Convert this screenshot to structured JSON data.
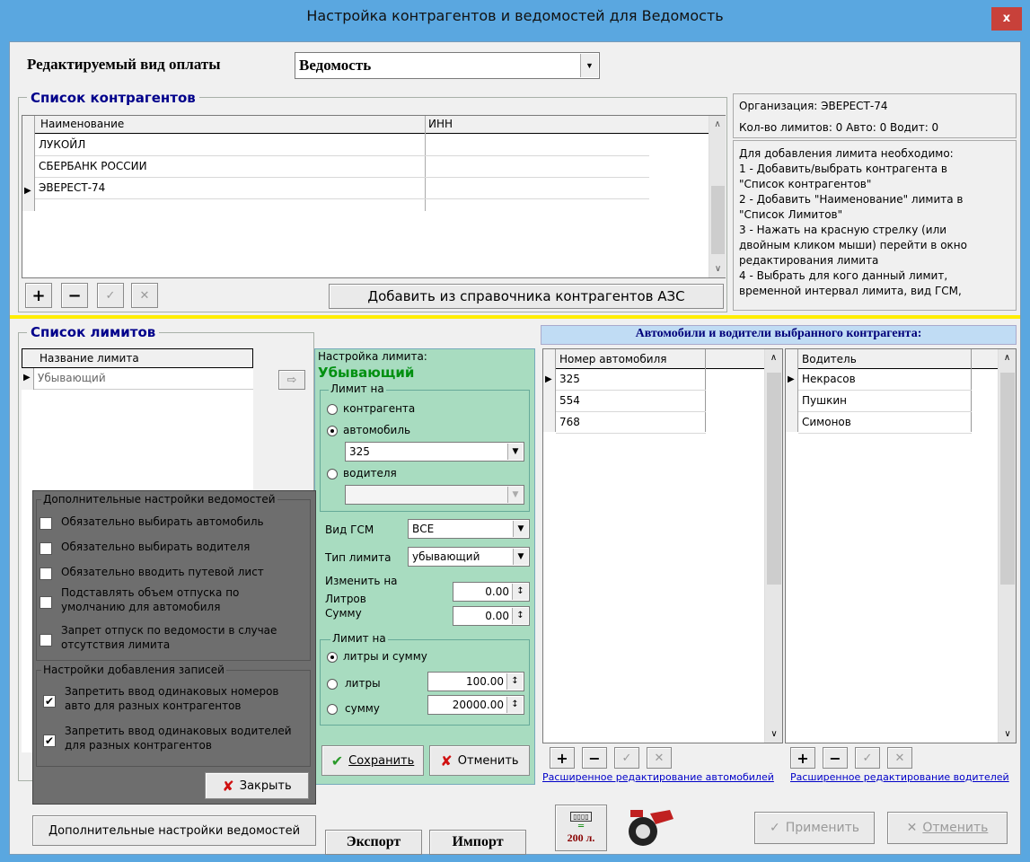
{
  "window": {
    "title": "Настройка контрагентов и ведомостей для Ведомость",
    "close": "x"
  },
  "payment": {
    "label": "Редактируемый вид оплаты",
    "value": "Ведомость"
  },
  "contractors": {
    "title": "Список контрагентов",
    "col_name": "Наименование",
    "col_inn": "ИНН",
    "rows": [
      {
        "name": "ЛУКОЙЛ",
        "inn": ""
      },
      {
        "name": "СБЕРБАНК РОССИИ",
        "inn": ""
      },
      {
        "name": "ЭВЕРЕСТ-74",
        "inn": ""
      }
    ],
    "add_from_ref": "Добавить из справочника контрагентов АЗС"
  },
  "info": {
    "org": "Организация: ЭВЕРЕСТ-74",
    "counts": "Кол-во лимитов: 0 Авто: 0 Водит: 0",
    "help": [
      "Для добавления лимита необходимо:",
      "1 - Добавить/выбрать контрагента в",
      "\"Список контрагентов\"",
      "2 - Добавить \"Наименование\" лимита в",
      "\"Список Лимитов\"",
      "3 - Нажать на красную стрелку (или",
      "двойным кликом мыши) перейти в окно",
      "редактирования лимита",
      "4 - Выбрать для кого данный лимит,",
      "временной интервал лимита, вид ГСМ,"
    ]
  },
  "limits": {
    "title": "Список лимитов",
    "col": "Название лимита",
    "rows": [
      "Убывающий"
    ]
  },
  "limit_settings": {
    "caption": "Настройка лимита:",
    "name": "Убывающий",
    "limit_on": "Лимит на",
    "opt_contractor": "контрагента",
    "opt_car": "автомобиль",
    "car_value": "325",
    "opt_driver": "водителя",
    "driver_value": "",
    "fuel_label": "Вид ГСМ",
    "fuel_value": "ВСЕ",
    "type_label": "Тип лимита",
    "type_value": "убывающий",
    "change_label": "Изменить на",
    "liters_label": "Литров",
    "liters_value": "0.00",
    "sum_label": "Сумму",
    "sum_value": "0.00",
    "limit_on2": "Лимит на",
    "opt_both": "литры и сумму",
    "opt_liters": "литры",
    "liters_limit": "100.00",
    "opt_sum": "сумму",
    "sum_limit": "20000.00",
    "save": "Сохранить",
    "cancel": "Отменить"
  },
  "vehicles": {
    "header": "Автомобили и водители выбранного контрагента:",
    "col_car": "Номер автомобиля",
    "cars": [
      "325",
      "554",
      "768"
    ],
    "col_driver": "Водитель",
    "drivers": [
      "Некрасов",
      "Пушкин",
      "Симонов"
    ],
    "link_cars": "Расширенное редактирование автомобилей",
    "link_drivers": "Расширенное редактирование водителей"
  },
  "extra": {
    "title": "Дополнительные настройки ведомостей",
    "items": [
      {
        "label": "Обязательно выбирать автомобиль",
        "checked": false
      },
      {
        "label": "Обязательно выбирать водителя",
        "checked": false
      },
      {
        "label": "Обязательно вводить путевой лист",
        "checked": false
      },
      {
        "label": "Подставлять объем отпуска по умолчанию для автомобиля",
        "checked": false
      },
      {
        "label": "Запрет отпуск по ведомости в случае отсутствия лимита",
        "checked": false
      }
    ],
    "add_title": "Настройки добавления записей",
    "add_items": [
      {
        "label": "Запретить ввод одинаковых номеров авто для разных контрагентов",
        "checked": true
      },
      {
        "label": "Запретить ввод одинаковых водителей для разных контрагентов",
        "checked": true
      }
    ],
    "close": "Закрыть"
  },
  "bottom": {
    "extra_settings": "Дополнительные настройки ведомостей",
    "export": "Экспорт",
    "import": "Импорт",
    "counter": "200 л.",
    "apply": "Применить",
    "cancel": "Отменить"
  }
}
